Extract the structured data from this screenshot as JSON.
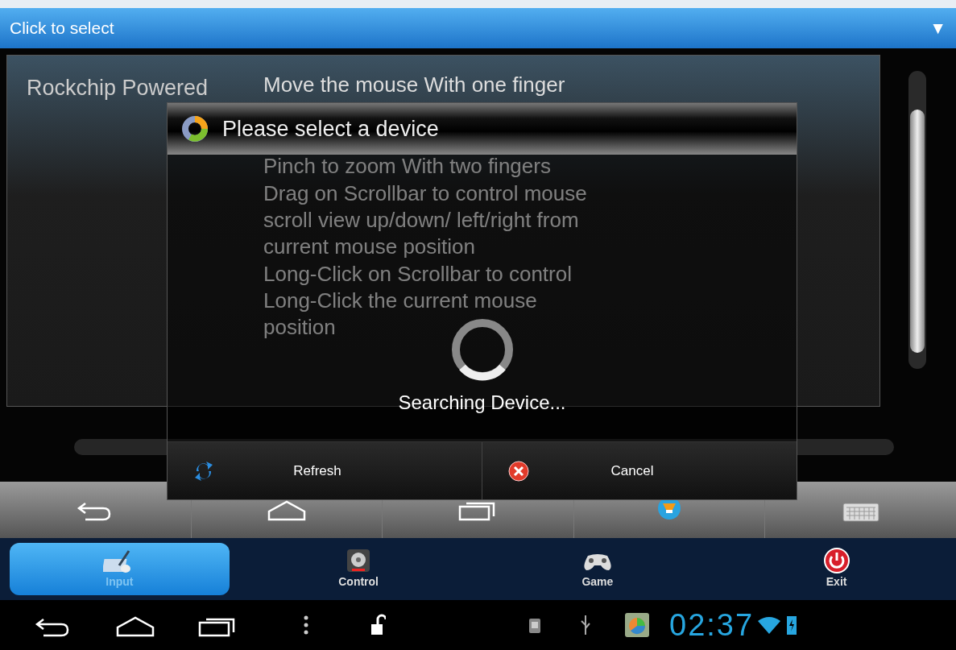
{
  "top_bar": {
    "label": "Click to select",
    "arrow": "▼"
  },
  "panel": {
    "title": "Rockchip Powered",
    "instructions": [
      "Move the mouse With one finger",
      "Pinch to zoom With two fingers",
      "Drag on Scrollbar to control mouse scroll view up/down/ left/right from current mouse position",
      "Long-Click on Scrollbar to control Long-Click the current mouse position"
    ]
  },
  "dialog": {
    "title": "Please select a device",
    "status": "Searching Device...",
    "buttons": [
      {
        "label": "Refresh",
        "kind": "refresh"
      },
      {
        "label": "Cancel",
        "kind": "cancel"
      }
    ]
  },
  "nav_keys": [
    {
      "kind": "back"
    },
    {
      "kind": "home"
    },
    {
      "kind": "recents"
    },
    {
      "kind": "app"
    },
    {
      "kind": "keyboard"
    }
  ],
  "tabs": [
    {
      "label": "Input",
      "kind": "input",
      "selected": true
    },
    {
      "label": "Control",
      "kind": "control",
      "selected": false
    },
    {
      "label": "Game",
      "kind": "game",
      "selected": false
    },
    {
      "label": "Exit",
      "kind": "exit",
      "selected": false
    }
  ],
  "status_bar": {
    "time": "02:37"
  }
}
